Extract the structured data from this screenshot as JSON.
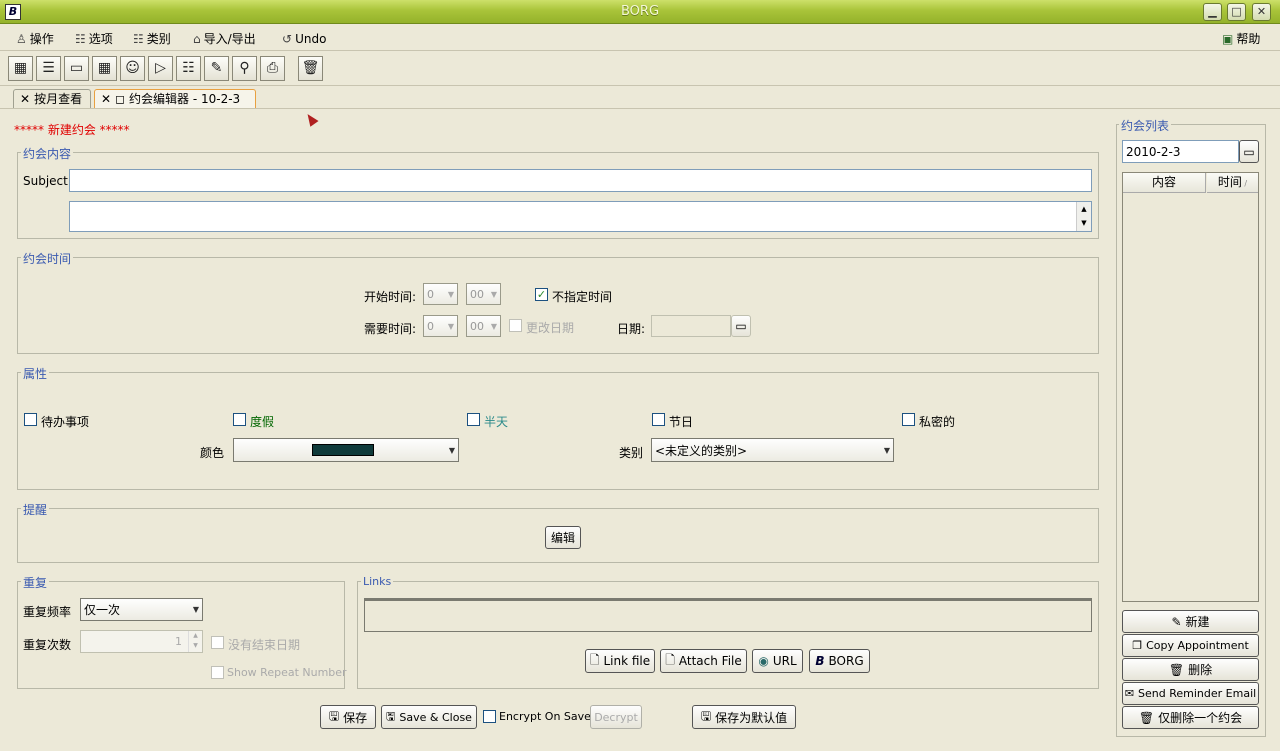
{
  "window": {
    "title": "BORG",
    "app_icon": "B",
    "min": "▁",
    "max": "□",
    "close": "✕"
  },
  "menu": {
    "items": [
      {
        "label": "操作",
        "icon": "bell-icon"
      },
      {
        "label": "选项",
        "icon": "list-icon"
      },
      {
        "label": "类别",
        "icon": "list-icon"
      },
      {
        "label": "导入/导出",
        "icon": "home-icon"
      },
      {
        "label": "Undo",
        "icon": "undo-icon"
      }
    ],
    "help": "帮助"
  },
  "toolbar": {
    "icons": [
      "month-grid-icon",
      "week-icon",
      "day-icon",
      "year-grid-icon",
      "address-book-icon",
      "edit-task-icon",
      "checklist-icon",
      "memo-icon",
      "search-binoculars-icon",
      "print-icon",
      "trash-icon"
    ]
  },
  "tabs": [
    {
      "label": "按月查看"
    },
    {
      "label": "约会编辑器 -   10-2-3"
    }
  ],
  "editor": {
    "new_label": "***** 新建约会 *****",
    "content": {
      "title": "约会内容",
      "subject_label": "Subject",
      "subject_value": "",
      "body_value": ""
    },
    "time": {
      "title": "约会时间",
      "start_label": "开始时间:",
      "start_hour": "0",
      "start_min": "00",
      "untimed_label": "不指定时间",
      "untimed_checked": true,
      "duration_label": "需要时间:",
      "dur_hour": "0",
      "dur_min": "00",
      "change_date_label": "更改日期",
      "date_label": "日期:",
      "date_value": ""
    },
    "props": {
      "title": "属性",
      "todo": "待办事项",
      "vacation": "度假",
      "halfday": "半天",
      "holiday": "节日",
      "private": "私密的",
      "color_label": "颜色",
      "color_value": "#0f3a3a",
      "category_label": "类别",
      "category_value": "<未定义的类别>"
    },
    "reminder": {
      "title": "提醒",
      "edit_btn": "编辑"
    },
    "repeat": {
      "title": "重复",
      "freq_label": "重复频率",
      "freq_value": "仅一次",
      "times_label": "重复次数",
      "times_value": "1",
      "no_end_label": "没有结束日期",
      "show_num_label": "Show Repeat Number"
    },
    "links": {
      "title": "Links",
      "link_file": "Link file",
      "attach_file": "Attach File",
      "url": "URL",
      "borg": "BORG"
    },
    "bottom": {
      "save": "保存",
      "save_close": "Save & Close",
      "encrypt": "Encrypt On Save",
      "decrypt": "Decrypt",
      "save_default": "保存为默认值"
    }
  },
  "appt_list": {
    "title": "约会列表",
    "date": "2010-2-3",
    "col_content": "内容",
    "col_time": "时间",
    "new_btn": "新建",
    "copy_btn": "Copy Appointment",
    "delete_btn": "删除",
    "email_btn": "Send Reminder Email",
    "delete_one_btn": "仅删除一个约会"
  }
}
